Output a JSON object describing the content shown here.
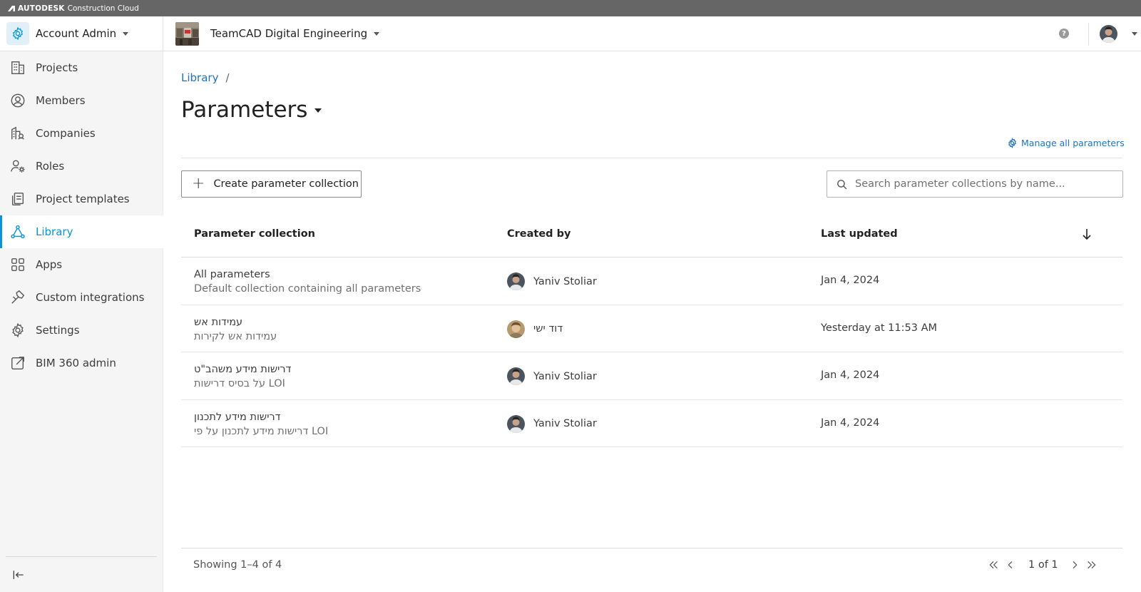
{
  "brandbar": {
    "brand": "AUTODESK",
    "product": "Construction Cloud"
  },
  "topbar": {
    "account_label": "Account Admin",
    "project_label": "TeamCAD Digital Engineering",
    "help_glyph": "?"
  },
  "sidebar": {
    "items": [
      {
        "label": "Projects",
        "icon": "building-icon"
      },
      {
        "label": "Members",
        "icon": "user-circle-icon"
      },
      {
        "label": "Companies",
        "icon": "company-icon"
      },
      {
        "label": "Roles",
        "icon": "user-gear-icon"
      },
      {
        "label": "Project templates",
        "icon": "template-icon"
      },
      {
        "label": "Library",
        "icon": "library-icon",
        "active": true
      },
      {
        "label": "Apps",
        "icon": "apps-grid-icon"
      },
      {
        "label": "Custom integrations",
        "icon": "hammer-icon"
      },
      {
        "label": "Settings",
        "icon": "gear-icon"
      },
      {
        "label": "BIM 360 admin",
        "icon": "external-link-icon"
      }
    ]
  },
  "main": {
    "breadcrumb": {
      "library": "Library",
      "separator": "/"
    },
    "title": "Parameters",
    "manage_link": "Manage all parameters",
    "create_button": "Create parameter collection",
    "search_placeholder": "Search parameter collections by name...",
    "columns": {
      "collection": "Parameter collection",
      "created_by": "Created by",
      "last_updated": "Last updated"
    },
    "rows": [
      {
        "name": "All parameters",
        "description": "Default collection containing all parameters",
        "created_by": "Yaniv Stoliar",
        "last_updated": "Jan 4, 2024"
      },
      {
        "name": "עמידות אש",
        "description": "עמידות אש לקירות",
        "created_by": "דוד ישי",
        "last_updated": "Yesterday at 11:53 AM"
      },
      {
        "name": "דרישות מידע משהב\"ט",
        "description": "על בסיס דרישות LOI",
        "created_by": "Yaniv Stoliar",
        "last_updated": "Jan 4, 2024"
      },
      {
        "name": "דרישות מידע לתכנון",
        "description": "דרישות מידע לתכנון על פי LOI",
        "created_by": "Yaniv Stoliar",
        "last_updated": "Jan 4, 2024"
      }
    ],
    "footer": {
      "showing": "Showing 1–4 of 4",
      "page": "1 of 1"
    }
  },
  "colors": {
    "accent": "#0696d7",
    "link": "#1e73be",
    "brandbar": "#666666",
    "sidebar_bg": "#f5f5f5"
  }
}
